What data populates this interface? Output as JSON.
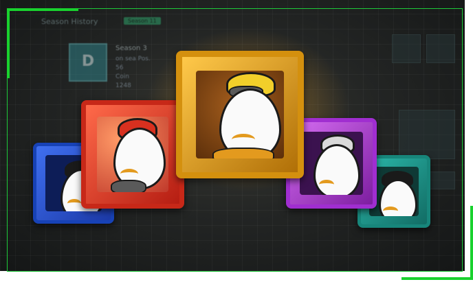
{
  "background_ui": {
    "panel_title": "Season History",
    "panel_tag": "Season 11",
    "rank_letter": "D",
    "season_label": "Season 3",
    "stat_line_1": "on sea Pos.",
    "stat_line_2": "56",
    "stat_line_3": "Coin",
    "stat_line_4": "1248"
  },
  "rewards": {
    "items": [
      {
        "name": "blue-avatar-frame",
        "color": "#2b55d6"
      },
      {
        "name": "red-avatar-frame",
        "color": "#e0402c"
      },
      {
        "name": "gold-avatar-frame",
        "color": "#e8a21c"
      },
      {
        "name": "purple-avatar-frame",
        "color": "#b13ad6"
      },
      {
        "name": "teal-avatar-frame",
        "color": "#1f9a8e"
      }
    ]
  },
  "colors": {
    "accent_green": "#1ecb3a",
    "glow_gold": "#ffcd46"
  }
}
